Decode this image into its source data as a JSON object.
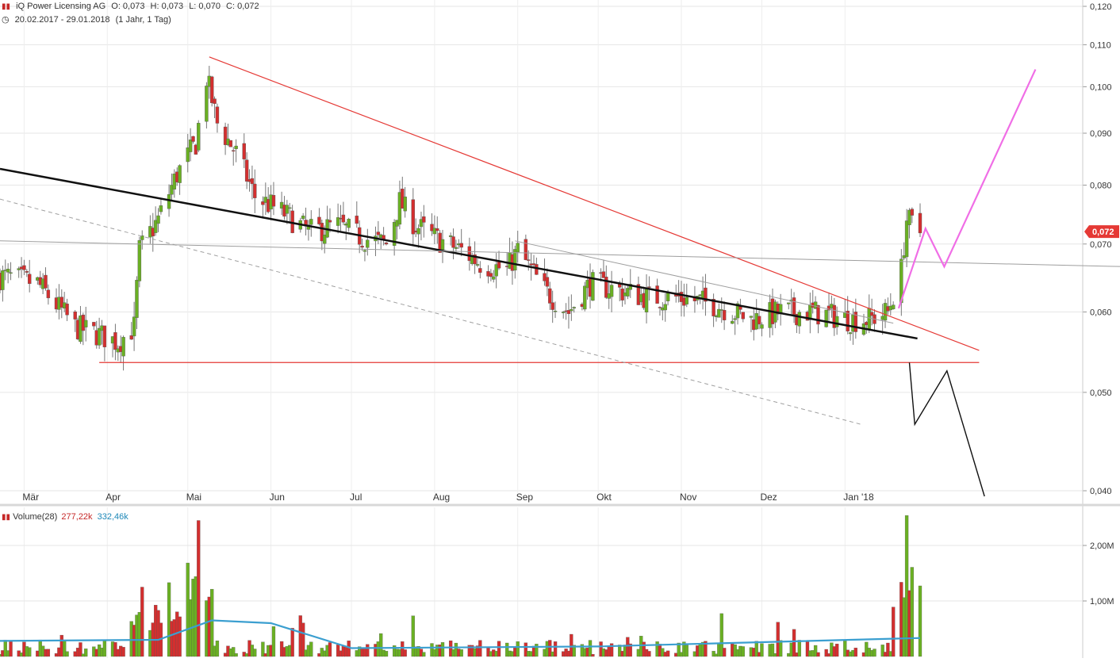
{
  "header": {
    "icon": "candlestick-icon",
    "instrument": "iQ Power Licensing AG",
    "open": "O: 0,073",
    "high": "H: 0,073",
    "low": "L: 0,070",
    "close": "C: 0,072",
    "range_icon": "clock-icon",
    "range": "20.02.2017 - 29.01.2018",
    "interval": "(1 Jahr, 1 Tag)"
  },
  "volume_header": {
    "icon": "bar-chart-icon",
    "label": "Volume(28)",
    "value": "277,22k",
    "avg": "332,46k"
  },
  "colors": {
    "up": "#6ab023",
    "down": "#d32f2f",
    "trend_red": "#e53935",
    "trend_black": "#111111",
    "trend_grey": "#9e9e9e",
    "projection_pink": "#f06ee6",
    "volume_ma": "#3b9fd0",
    "price_badge": "#e53935"
  },
  "chart_data": [
    {
      "type": "candlestick",
      "title": "iQ Power Licensing AG",
      "x_range": [
        "2017-02-20",
        "2018-01-29"
      ],
      "x_tick_labels": [
        "Mär",
        "Apr",
        "Mai",
        "Jun",
        "Jul",
        "Aug",
        "Sep",
        "Okt",
        "Nov",
        "Dez",
        "Jan '18"
      ],
      "y_scale": "log",
      "y_tick_labels": [
        "0,120",
        "0,110",
        "0,100",
        "0,090",
        "0,080",
        "0,070",
        "0,060",
        "0,050",
        "0,040"
      ],
      "last_price_label": "0,072",
      "grid": true,
      "candles_ohlc_anchors": [
        [
          "2017-02-22",
          0.065
        ],
        [
          "2017-03-06",
          0.064
        ],
        [
          "2017-03-20",
          0.058
        ],
        [
          "2017-03-29",
          0.057
        ],
        [
          "2017-04-05",
          0.056
        ],
        [
          "2017-04-11",
          0.058
        ],
        [
          "2017-04-13",
          0.069
        ],
        [
          "2017-04-20",
          0.074
        ],
        [
          "2017-04-27",
          0.082
        ],
        [
          "2017-05-04",
          0.088
        ],
        [
          "2017-05-08",
          0.102
        ],
        [
          "2017-05-12",
          0.092
        ],
        [
          "2017-05-19",
          0.086
        ],
        [
          "2017-05-26",
          0.078
        ],
        [
          "2017-06-06",
          0.075
        ],
        [
          "2017-06-15",
          0.072
        ],
        [
          "2017-06-26",
          0.073
        ],
        [
          "2017-07-05",
          0.071
        ],
        [
          "2017-07-14",
          0.07
        ],
        [
          "2017-07-19",
          0.077
        ],
        [
          "2017-07-25",
          0.073
        ],
        [
          "2017-08-01",
          0.071
        ],
        [
          "2017-08-11",
          0.069
        ],
        [
          "2017-08-18",
          0.067
        ],
        [
          "2017-08-28",
          0.066
        ],
        [
          "2017-09-01",
          0.069
        ],
        [
          "2017-09-11",
          0.063
        ],
        [
          "2017-09-20",
          0.06
        ],
        [
          "2017-09-28",
          0.064
        ],
        [
          "2017-10-09",
          0.063
        ],
        [
          "2017-10-20",
          0.062
        ],
        [
          "2017-10-31",
          0.062
        ],
        [
          "2017-11-14",
          0.061
        ],
        [
          "2017-11-27",
          0.059
        ],
        [
          "2017-12-08",
          0.06
        ],
        [
          "2017-12-20",
          0.06
        ],
        [
          "2018-01-03",
          0.059
        ],
        [
          "2018-01-10",
          0.059
        ],
        [
          "2018-01-17",
          0.06
        ],
        [
          "2018-01-22",
          0.066
        ],
        [
          "2018-01-24",
          0.074
        ],
        [
          "2018-01-29",
          0.072
        ]
      ],
      "trendlines": [
        {
          "name": "resistance",
          "color": "red",
          "from": [
            "2017-05-09",
            0.107
          ],
          "to": [
            "2018-02-20",
            0.055
          ]
        },
        {
          "name": "support",
          "color": "red",
          "from": [
            "2017-03-29",
            0.0535
          ],
          "to": [
            "2018-02-20",
            0.0535
          ]
        },
        {
          "name": "main trend",
          "color": "black",
          "from": [
            "2017-02-20",
            0.083
          ],
          "to": [
            "2018-01-28",
            0.0565
          ]
        },
        {
          "name": "channel",
          "color": "grey-dashed",
          "from": [
            "2017-02-20",
            0.0775
          ],
          "to": [
            "2018-01-07",
            0.0465
          ]
        },
        {
          "name": "horizontal",
          "color": "grey",
          "from": [
            "2017-02-20",
            0.0705
          ],
          "to": [
            "2018-04-15",
            0.0665
          ]
        },
        {
          "name": "inner",
          "color": "grey",
          "from": [
            "2017-08-31",
            0.0705
          ],
          "to": [
            "2018-01-19",
            0.0585
          ]
        }
      ],
      "projections": [
        {
          "name": "bullish",
          "color": "pink",
          "points": [
            [
              "2018-01-21",
              0.0605
            ],
            [
              "2018-01-31",
              0.0725
            ],
            [
              "2018-02-07",
              0.0665
            ],
            [
              "2018-03-13",
              0.104
            ]
          ]
        },
        {
          "name": "bearish",
          "color": "black",
          "points": [
            [
              "2018-01-25",
              0.0535
            ],
            [
              "2018-01-27",
              0.0465
            ],
            [
              "2018-02-08",
              0.0525
            ],
            [
              "2018-02-22",
              0.0395
            ]
          ]
        }
      ]
    },
    {
      "type": "bar",
      "title": "Volume(28)",
      "y_scale": "linear",
      "y_tick_labels": [
        "2,00M",
        "1,00M"
      ],
      "ylim": [
        0,
        2600000
      ],
      "series": [
        {
          "name": "Volume",
          "peaks": [
            [
              "2017-04-14",
              1250000
            ],
            [
              "2017-04-24",
              1330000
            ],
            [
              "2017-05-05",
              2450000
            ],
            [
              "2018-01-24",
              2540000
            ]
          ]
        },
        {
          "name": "MA(28)",
          "anchors": [
            [
              "2017-02-20",
              280000
            ],
            [
              "2017-04-20",
              300000
            ],
            [
              "2017-05-10",
              650000
            ],
            [
              "2017-06-01",
              600000
            ],
            [
              "2017-07-01",
              150000
            ],
            [
              "2017-10-01",
              180000
            ],
            [
              "2018-01-29",
              332460
            ]
          ]
        }
      ]
    }
  ]
}
